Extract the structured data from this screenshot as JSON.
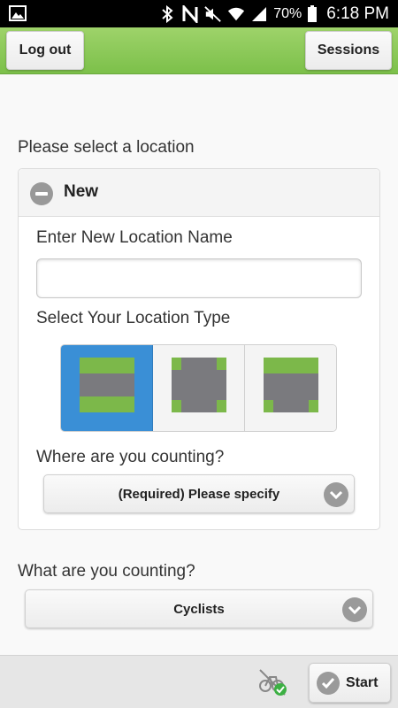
{
  "status_bar": {
    "icons": [
      "image-icon",
      "bluetooth-icon",
      "nfc-icon",
      "mute-icon",
      "wifi-icon",
      "signal-icon",
      "battery-icon"
    ],
    "battery": "70%",
    "time": "6:18 PM"
  },
  "header": {
    "logout_label": "Log out",
    "sessions_label": "Sessions"
  },
  "location": {
    "prompt": "Please select a location",
    "panel_title": "New",
    "name_label": "Enter New Location Name",
    "name_value": "",
    "type_label": "Select Your Location Type",
    "types": [
      {
        "name": "straight-road",
        "selected": true
      },
      {
        "name": "four-way-intersection",
        "selected": false
      },
      {
        "name": "t-intersection",
        "selected": false
      }
    ],
    "where_label": "Where are you counting?",
    "where_value": "(Required) Please specify"
  },
  "counting": {
    "label": "What are you counting?",
    "value": "Cyclists"
  },
  "footer": {
    "start_label": "Start"
  },
  "colors": {
    "header_green": "#8cc95a",
    "active_blue": "#3a8fd6",
    "road_gray": "#7a7a7e",
    "grass_green": "#7cb84a"
  }
}
